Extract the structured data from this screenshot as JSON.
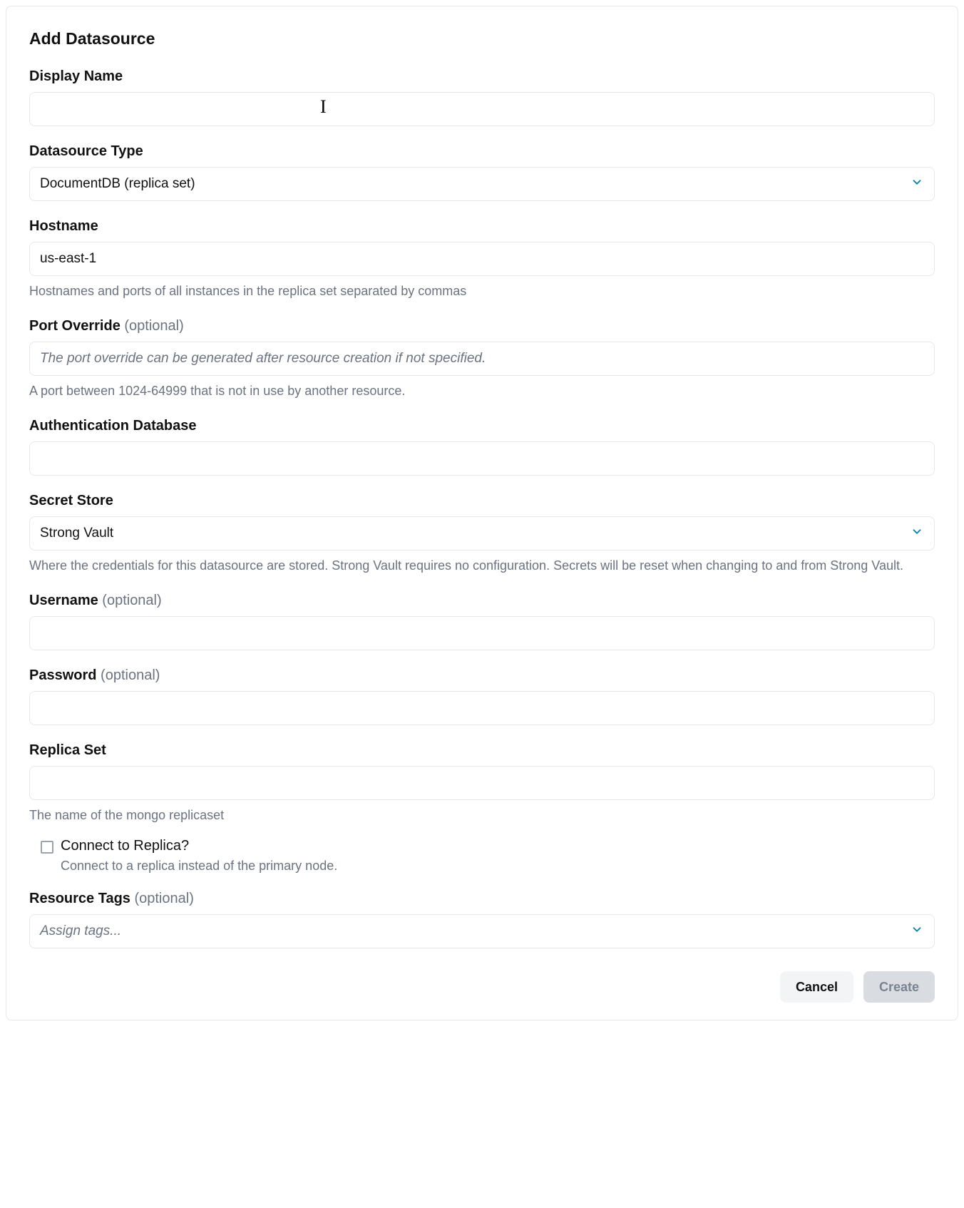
{
  "title": "Add Datasource",
  "fields": {
    "display_name": {
      "label": "Display Name",
      "value": ""
    },
    "datasource_type": {
      "label": "Datasource Type",
      "value": "DocumentDB (replica set)"
    },
    "hostname": {
      "label": "Hostname",
      "value": "us-east-1",
      "hint": "Hostnames and ports of all instances in the replica set separated by commas"
    },
    "port_override": {
      "label": "Port Override",
      "optional": "(optional)",
      "placeholder": "The port override can be generated after resource creation if not specified.",
      "value": "",
      "hint": "A port between 1024-64999 that is not in use by another resource."
    },
    "auth_db": {
      "label": "Authentication Database",
      "value": ""
    },
    "secret_store": {
      "label": "Secret Store",
      "value": "Strong Vault",
      "hint": "Where the credentials for this datasource are stored. Strong Vault requires no configuration. Secrets will be reset when changing to and from Strong Vault."
    },
    "username": {
      "label": "Username",
      "optional": "(optional)",
      "value": ""
    },
    "password": {
      "label": "Password",
      "optional": "(optional)",
      "value": ""
    },
    "replica_set": {
      "label": "Replica Set",
      "value": "",
      "hint": "The name of the mongo replicaset"
    },
    "connect_replica": {
      "label": "Connect to Replica?",
      "hint": "Connect to a replica instead of the primary node.",
      "checked": false
    },
    "resource_tags": {
      "label": "Resource Tags",
      "optional": "(optional)",
      "placeholder": "Assign tags..."
    }
  },
  "footer": {
    "cancel": "Cancel",
    "create": "Create"
  }
}
